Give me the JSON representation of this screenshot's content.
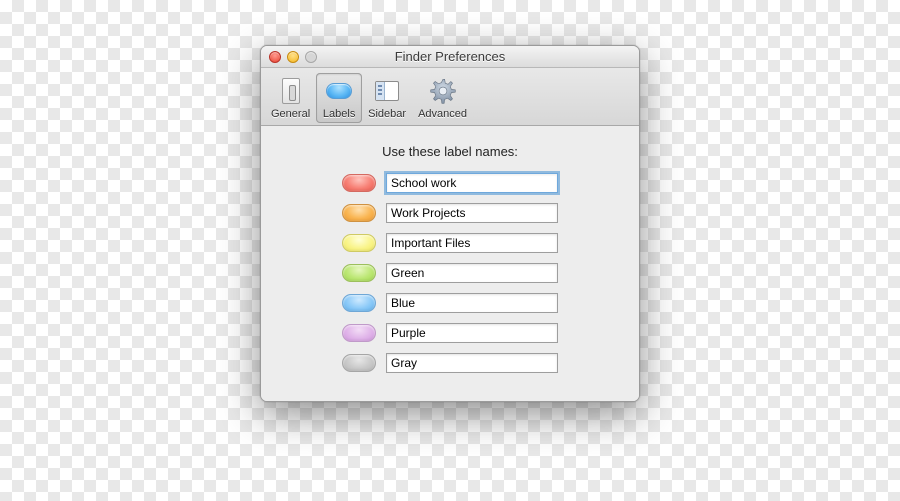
{
  "window": {
    "title": "Finder Preferences"
  },
  "toolbar": {
    "tabs": [
      {
        "label": "General",
        "icon": "switch-icon",
        "selected": false
      },
      {
        "label": "Labels",
        "icon": "label-pill-icon",
        "selected": true
      },
      {
        "label": "Sidebar",
        "icon": "sidebar-icon",
        "selected": false
      },
      {
        "label": "Advanced",
        "icon": "gear-icon",
        "selected": false
      }
    ]
  },
  "body": {
    "heading": "Use these label names:",
    "labels": [
      {
        "color": "red",
        "swatch": "#ea5a4e",
        "value": "School work",
        "focused": true
      },
      {
        "color": "orange",
        "swatch": "#ef9a2e",
        "value": "Work Projects",
        "focused": false
      },
      {
        "color": "yellow",
        "swatch": "#f0e95e",
        "value": "Important Files",
        "focused": false
      },
      {
        "color": "green",
        "swatch": "#a1d94e",
        "value": "Green",
        "focused": false
      },
      {
        "color": "blue",
        "swatch": "#5fb0ed",
        "value": "Blue",
        "focused": false
      },
      {
        "color": "purple",
        "swatch": "#d196de",
        "value": "Purple",
        "focused": false
      },
      {
        "color": "gray",
        "swatch": "#b6b6b6",
        "value": "Gray",
        "focused": false
      }
    ]
  }
}
